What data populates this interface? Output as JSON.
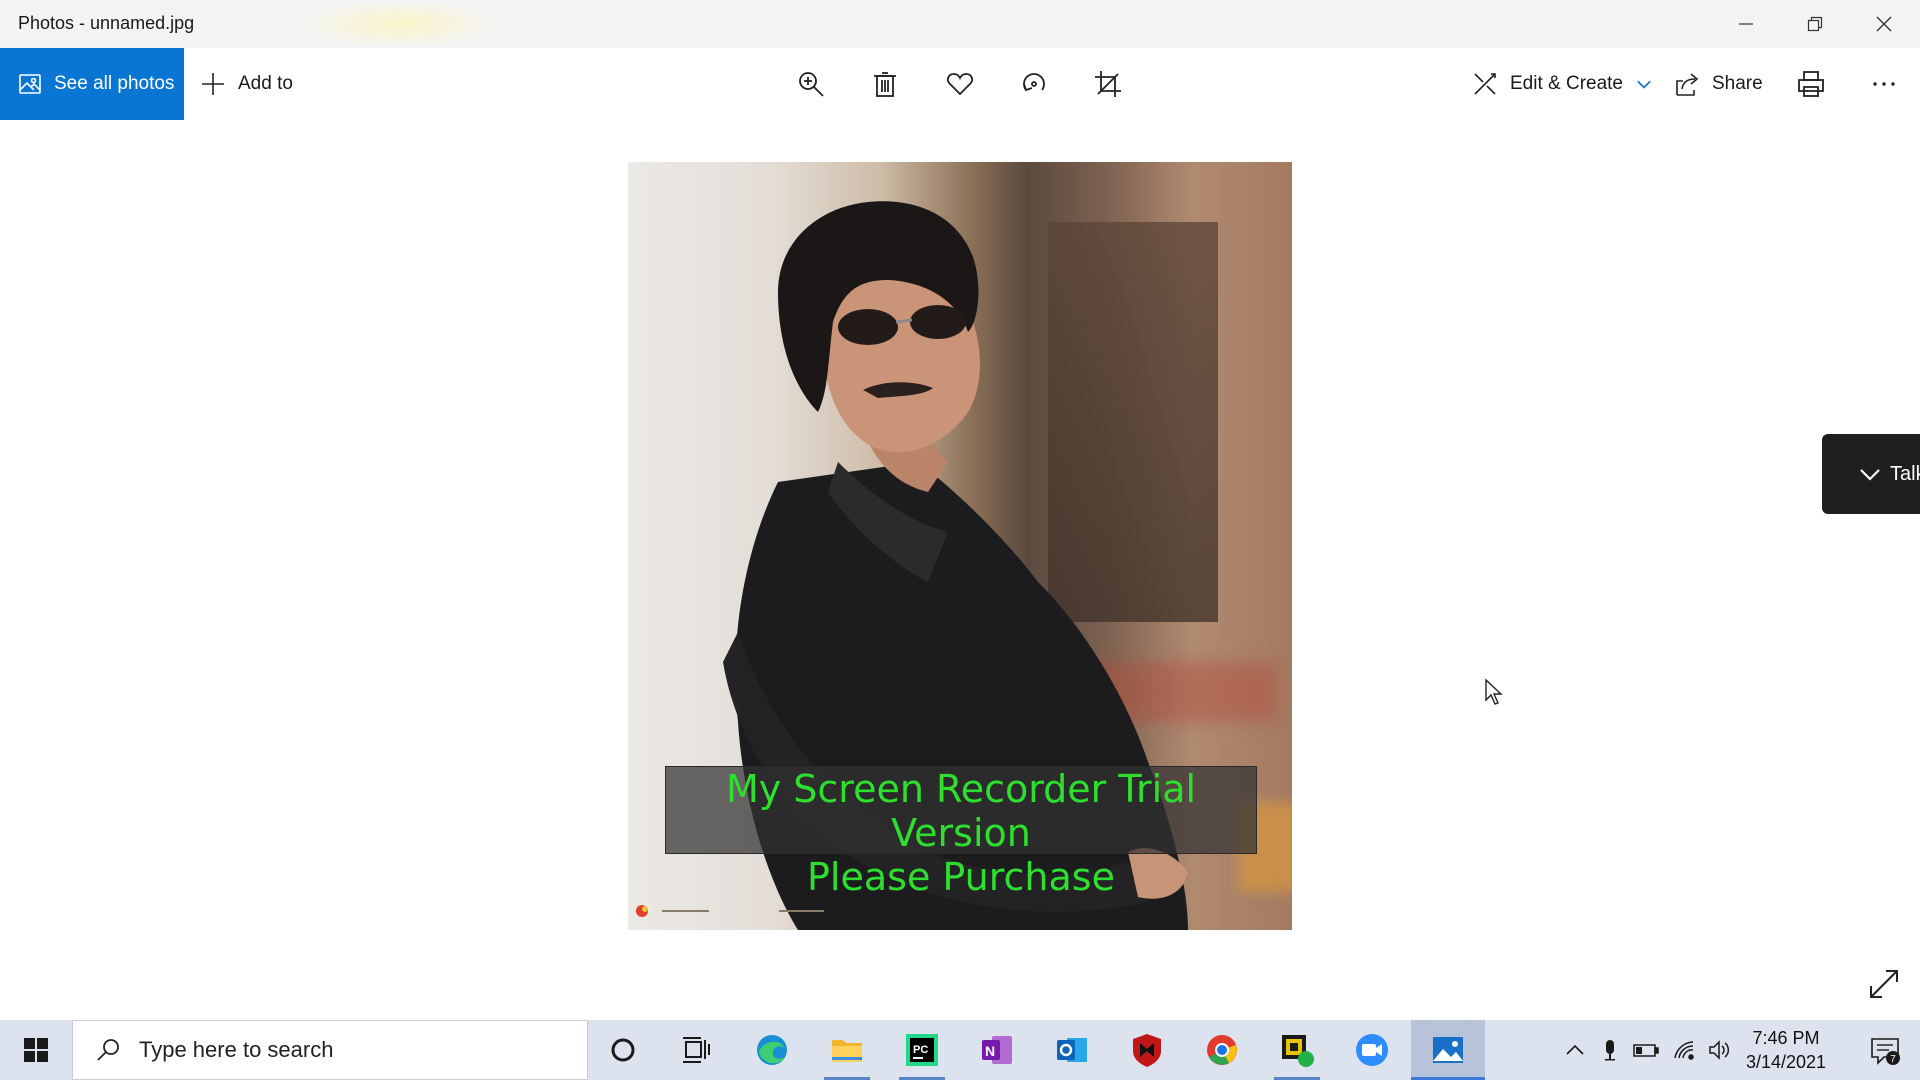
{
  "window": {
    "title": "Photos - unnamed.jpg",
    "controls": [
      "minimize-icon",
      "restore-icon",
      "close-icon"
    ]
  },
  "toolbar": {
    "see_all_label": "See all photos",
    "add_to_label": "Add to",
    "tools": [
      "zoom-in-icon",
      "delete-icon",
      "favorite-heart-icon",
      "rotate-icon",
      "crop-icon"
    ],
    "edit_create_label": "Edit & Create",
    "share_label": "Share",
    "print_icon": "print-icon",
    "more_icon": "more-ellipsis-icon",
    "accent_color": "#0a76d4"
  },
  "photo": {
    "watermark_line1": "My Screen Recorder Trial Version",
    "watermark_line2": "Please Purchase",
    "watermark_color": "#2ee02e"
  },
  "talk_panel": {
    "label": "Talk"
  },
  "taskbar": {
    "search_placeholder": "Type here to search",
    "apps": [
      "cortana-icon",
      "task-view-icon",
      "edge-icon",
      "file-explorer-icon",
      "pycharm-icon",
      "onenote-icon",
      "outlook-icon",
      "mcafee-icon",
      "chrome-icon",
      "app-icon",
      "zoom-icon",
      "photos-icon"
    ],
    "tray": [
      "show-hidden-icons-chevron",
      "microphone-icon",
      "battery-icon",
      "wifi-icon",
      "volume-icon"
    ],
    "time": "7:46 PM",
    "date": "3/14/2021",
    "notification_count": "7"
  }
}
